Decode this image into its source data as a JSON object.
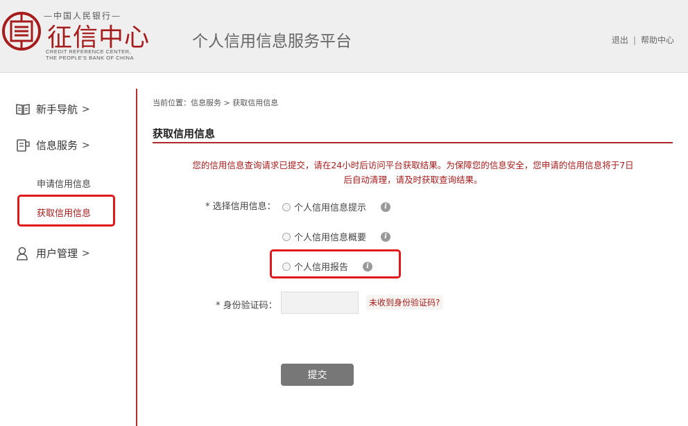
{
  "header": {
    "logo_top": "—中国人民银行—",
    "logo_main": "征信中心",
    "logo_en_line1": "CREDIT REFERENCE CENTER,",
    "logo_en_line2": "THE PEOPLE'S BANK OF CHINA",
    "site_title": "个人信用信息服务平台",
    "links": {
      "logout": "退出",
      "separator": "|",
      "help": "帮助中心"
    }
  },
  "sidebar": {
    "items": [
      {
        "label": "新手导航",
        "chevron": ">",
        "icon": "book-icon"
      },
      {
        "label": "信息服务",
        "chevron": ">",
        "icon": "document-icon"
      },
      {
        "label": "用户管理",
        "chevron": ">",
        "icon": "user-icon"
      }
    ],
    "sub_items": [
      {
        "label": "申请信用信息"
      },
      {
        "label": "获取信用信息",
        "active": true
      }
    ]
  },
  "main": {
    "breadcrumb": "当前位置：信息服务 > 获取信用信息",
    "title": "获取信用信息",
    "notice_line1": "您的信用信息查询请求已提交，请在24小时后访问平台获取结果。为保障您的信息安全，您申请的信用信息将于7日",
    "notice_line2": "后自动清理，请及时获取查询结果。",
    "select_label": "* 选择信用信息：",
    "options": [
      {
        "label": "个人信用信息提示"
      },
      {
        "label": "个人信用信息概要"
      },
      {
        "label": "个人信用报告"
      }
    ],
    "info_glyph": "i",
    "code_label": "* 身份验证码：",
    "code_value": "",
    "no_code_link": "未收到身份验证码?",
    "submit_label": "提交"
  },
  "colors": {
    "brand_red": "#a61b1b",
    "highlight_red": "#e0171b",
    "header_bg": "#efefef",
    "button_gray": "#777777"
  }
}
